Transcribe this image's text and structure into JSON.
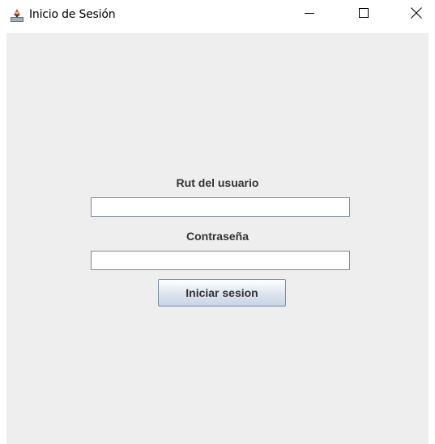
{
  "window": {
    "title": "Inicio de Sesión",
    "icon": "java-app-icon",
    "controls": {
      "minimize_icon": "minimize-icon",
      "maximize_icon": "maximize-icon",
      "close_icon": "close-icon"
    }
  },
  "form": {
    "user_label": "Rut del usuario",
    "user_value": "",
    "password_label": "Contraseña",
    "password_value": "",
    "submit_label": "Iniciar sesion"
  },
  "colors": {
    "panel_background": "#eeeeee",
    "label_text": "#333333",
    "field_border": "#7a8a9e"
  }
}
